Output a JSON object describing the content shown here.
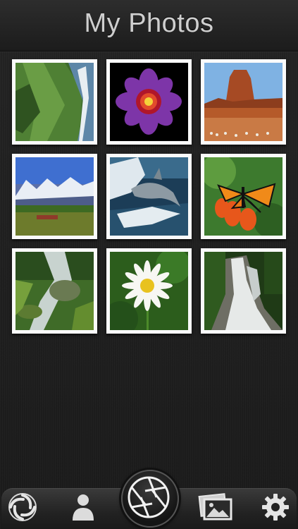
{
  "header": {
    "title": "My Photos"
  },
  "photos": [
    {
      "name": "photo-sea-cliffs"
    },
    {
      "name": "photo-purple-flower"
    },
    {
      "name": "photo-desert-butte"
    },
    {
      "name": "photo-snowy-mountains"
    },
    {
      "name": "photo-dolphin"
    },
    {
      "name": "photo-monarch-butterfly"
    },
    {
      "name": "photo-mountain-stream"
    },
    {
      "name": "photo-daisy"
    },
    {
      "name": "photo-waterfall"
    }
  ],
  "tabbar": {
    "items": [
      {
        "icon": "swirl-icon"
      },
      {
        "icon": "person-icon"
      },
      {
        "icon": "camera-shutter-icon"
      },
      {
        "icon": "photos-icon"
      },
      {
        "icon": "gear-icon"
      }
    ]
  }
}
